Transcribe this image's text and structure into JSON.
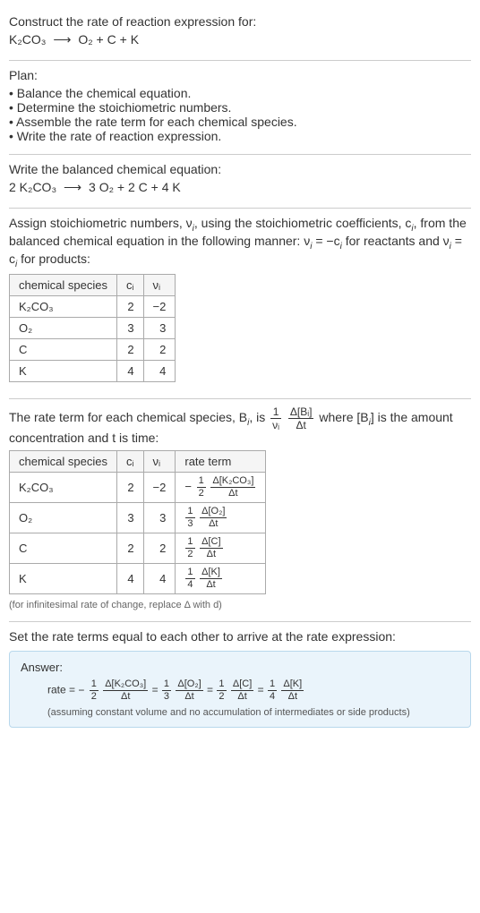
{
  "prompt": {
    "title": "Construct the rate of reaction expression for:",
    "reactant": "K₂CO₃",
    "arrow": "⟶",
    "products": "O₂ + C + K"
  },
  "plan": {
    "title": "Plan:",
    "steps": [
      "Balance the chemical equation.",
      "Determine the stoichiometric numbers.",
      "Assemble the rate term for each chemical species.",
      "Write the rate of reaction expression."
    ]
  },
  "balanced": {
    "title": "Write the balanced chemical equation:",
    "lhs": "2 K₂CO₃",
    "arrow": "⟶",
    "rhs": "3 O₂ + 2 C + 4 K"
  },
  "stoich_text": {
    "part1": "Assign stoichiometric numbers, ν",
    "sub_i1": "i",
    "part2": ", using the stoichiometric coefficients, c",
    "sub_i2": "i",
    "part3": ", from the balanced chemical equation in the following manner: ν",
    "sub_i3": "i",
    "part4": " = −c",
    "sub_i4": "i",
    "part5": " for reactants and ν",
    "sub_i5": "i",
    "part6": " = c",
    "sub_i6": "i",
    "part7": " for products:"
  },
  "stoich_table": {
    "headers": [
      "chemical species",
      "cᵢ",
      "νᵢ"
    ],
    "rows": [
      {
        "species": "K₂CO₃",
        "c": "2",
        "nu": "−2"
      },
      {
        "species": "O₂",
        "c": "3",
        "nu": "3"
      },
      {
        "species": "C",
        "c": "2",
        "nu": "2"
      },
      {
        "species": "K",
        "c": "4",
        "nu": "4"
      }
    ]
  },
  "rate_text": {
    "part1": "The rate term for each chemical species, B",
    "sub_i": "i",
    "part2": ", is ",
    "frac1_top": "1",
    "frac1_bot": "νᵢ",
    "frac2_top": "Δ[Bᵢ]",
    "frac2_bot": "Δt",
    "part3": " where [B",
    "sub_i2": "i",
    "part4": "] is the amount concentration and t is time:"
  },
  "rate_table": {
    "headers": [
      "chemical species",
      "cᵢ",
      "νᵢ",
      "rate term"
    ],
    "rows": [
      {
        "species": "K₂CO₃",
        "c": "2",
        "nu": "−2",
        "coef_top": "1",
        "coef_bot": "2",
        "neg": "−",
        "delta_top": "Δ[K₂CO₃]",
        "delta_bot": "Δt"
      },
      {
        "species": "O₂",
        "c": "3",
        "nu": "3",
        "coef_top": "1",
        "coef_bot": "3",
        "neg": "",
        "delta_top": "Δ[O₂]",
        "delta_bot": "Δt"
      },
      {
        "species": "C",
        "c": "2",
        "nu": "2",
        "coef_top": "1",
        "coef_bot": "2",
        "neg": "",
        "delta_top": "Δ[C]",
        "delta_bot": "Δt"
      },
      {
        "species": "K",
        "c": "4",
        "nu": "4",
        "coef_top": "1",
        "coef_bot": "4",
        "neg": "",
        "delta_top": "Δ[K]",
        "delta_bot": "Δt"
      }
    ]
  },
  "infinitesimal_note": "(for infinitesimal rate of change, replace Δ with d)",
  "final_title": "Set the rate terms equal to each other to arrive at the rate expression:",
  "answer": {
    "label": "Answer:",
    "rate_prefix": "rate = ",
    "terms": [
      {
        "neg": "−",
        "coef_top": "1",
        "coef_bot": "2",
        "delta_top": "Δ[K₂CO₃]",
        "delta_bot": "Δt"
      },
      {
        "neg": "",
        "coef_top": "1",
        "coef_bot": "3",
        "delta_top": "Δ[O₂]",
        "delta_bot": "Δt"
      },
      {
        "neg": "",
        "coef_top": "1",
        "coef_bot": "2",
        "delta_top": "Δ[C]",
        "delta_bot": "Δt"
      },
      {
        "neg": "",
        "coef_top": "1",
        "coef_bot": "4",
        "delta_top": "Δ[K]",
        "delta_bot": "Δt"
      }
    ],
    "eq": " = ",
    "assume": "(assuming constant volume and no accumulation of intermediates or side products)"
  }
}
